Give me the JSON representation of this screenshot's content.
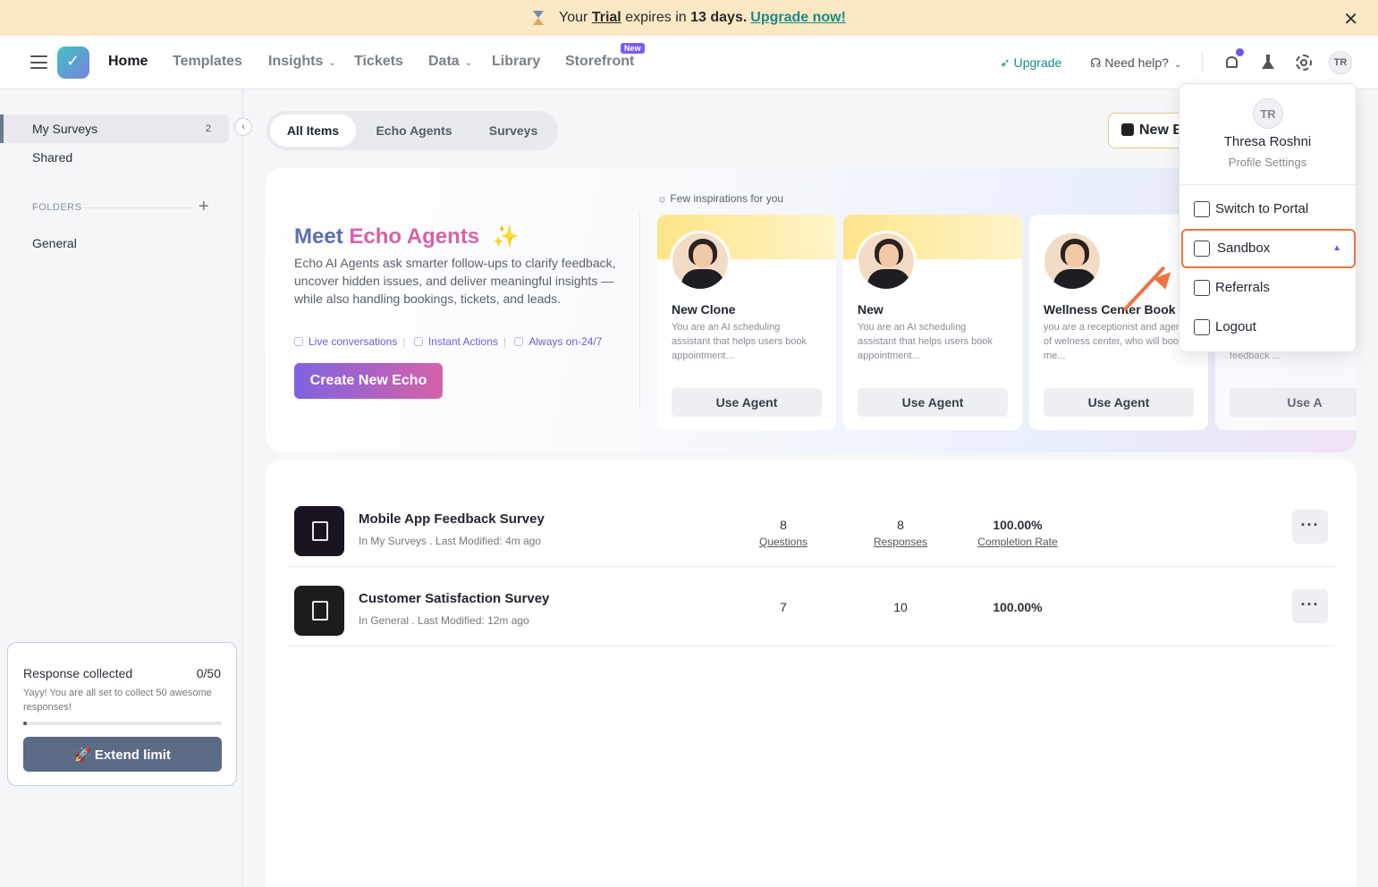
{
  "banner": {
    "prefix": "Your",
    "trial": "Trial",
    "mid": "expires in",
    "days": "13 days.",
    "cta": "Upgrade now!"
  },
  "nav": {
    "items": [
      "Home",
      "Templates",
      "Insights",
      "Tickets",
      "Data",
      "Library",
      "Storefront"
    ],
    "new_badge": "New",
    "upgrade": "Upgrade",
    "help": "Need help?",
    "avatar": "TR"
  },
  "sidebar": {
    "items": [
      {
        "label": "My Surveys",
        "count": "2"
      },
      {
        "label": "Shared"
      }
    ],
    "folders_label": "FOLDERS",
    "folders": [
      "General"
    ],
    "response": {
      "title": "Response collected",
      "count": "0/50",
      "text": "Yayy! You are all set to collect 50 awesome responses!",
      "progress": 0,
      "button": "🚀 Extend limit"
    }
  },
  "tabs": [
    "All Items",
    "Echo Agents",
    "Surveys"
  ],
  "new_echo": "New E",
  "hero": {
    "title_meet": "Meet",
    "title_echo": "Echo Agents",
    "spark": "✨",
    "desc": "Echo AI Agents ask smarter follow-ups to clarify feedback, uncover hidden issues, and deliver meaningful insights — while also handling bookings, tickets, and leads.",
    "features": [
      "Live conversations",
      "Instant Actions",
      "Always on-24/7"
    ],
    "create_button": "Create New Echo",
    "inspirations": "Few inspirations for you",
    "agents": [
      {
        "name": "New Clone",
        "desc": "You are an AI scheduling assistant that helps users book appointment...",
        "button": "Use Agent"
      },
      {
        "name": "New",
        "desc": "You are an AI scheduling assistant that helps users book appointment...",
        "button": "Use Agent"
      },
      {
        "name": "Wellness Center Book",
        "desc": "you are a receptionist and agent of welness center, who will book me...",
        "button": "Use Agent"
      },
      {
        "name": "",
        "desc": "feedback ...",
        "button": "Use A"
      }
    ]
  },
  "surveys": [
    {
      "name": "Mobile App Feedback Survey",
      "meta": "In My Surveys . Last Modified: 4m ago",
      "questions": "8",
      "responses": "8",
      "completion": "100.00%",
      "q_label": "Questions",
      "r_label": "Responses",
      "c_label": "Completion Rate"
    },
    {
      "name": "Customer Satisfaction Survey",
      "meta": "In General . Last Modified: 12m ago",
      "questions": "7",
      "responses": "10",
      "completion": "100.00%"
    }
  ],
  "profile_menu": {
    "avatar": "TR",
    "name": "Thresa Roshni",
    "sub": "Profile Settings",
    "items": [
      "Switch to Portal",
      "Sandbox",
      "Referrals",
      "Logout"
    ],
    "selected": "Sandbox",
    "highlight_color": "#ef7240"
  }
}
